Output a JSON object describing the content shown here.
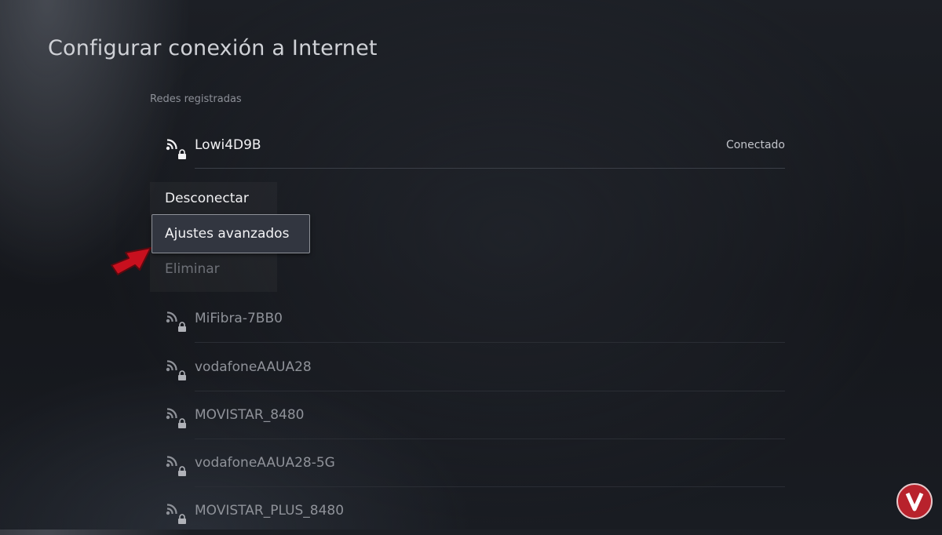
{
  "page": {
    "title": "Configurar conexión a Internet"
  },
  "registered": {
    "label": "Redes registradas",
    "connected": {
      "name": "Lowi4D9B",
      "status": "Conectado",
      "icon": "wifi-lock-icon"
    }
  },
  "menu": {
    "items": [
      {
        "label": "Desconectar",
        "state": "enabled"
      },
      {
        "label": "Ajustes avanzados",
        "state": "focused"
      },
      {
        "label": "Eliminar",
        "state": "disabled"
      }
    ]
  },
  "networks": [
    {
      "name": "MiFibra-7BB0",
      "icon": "wifi-lock-icon"
    },
    {
      "name": "vodafoneAAUA28",
      "icon": "wifi-lock-icon"
    },
    {
      "name": "MOVISTAR_8480",
      "icon": "wifi-lock-icon"
    },
    {
      "name": "vodafoneAAUA28-5G",
      "icon": "wifi-lock-icon"
    },
    {
      "name": "MOVISTAR_PLUS_8480",
      "icon": "wifi-lock-icon"
    }
  ],
  "colors": {
    "arrow": "#c8101e",
    "focus_border": "#8e9198",
    "logo": "#b8222c"
  }
}
